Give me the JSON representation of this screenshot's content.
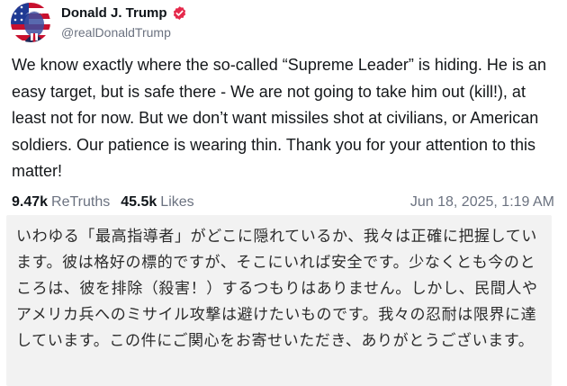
{
  "author": {
    "display_name": "Donald J. Trump",
    "handle": "@realDonaldTrump",
    "avatar_icon": "profile-photo-flag-icon",
    "verified_icon": "verified-badge-icon",
    "verified_color": "#e5294b"
  },
  "post": {
    "text": "We know exactly where the so-called “Supreme Leader” is hiding. He is an easy target, but is safe there - We are not going to take him out (kill!), at least not for now. But we don’t want missiles shot at civilians, or American soldiers. Our patience is wearing thin. Thank you for your attention to this matter!"
  },
  "stats": {
    "retruths_count": "9.47k",
    "retruths_label": "ReTruths",
    "likes_count": "45.5k",
    "likes_label": "Likes",
    "timestamp": "Jun 18, 2025, 1:19 AM"
  },
  "translation": {
    "text": "いわゆる「最高指導者」がどこに隠れているか、我々は正確に把握しています。彼は格好の標的ですが、そこにいれば安全です。少なくとも今のところは、彼を排除（殺害！）するつもりはありません。しかし、民間人やアメリカ兵へのミサイル攻撃は避けたいものです。我々の忍耐は限界に達しています。この件にご関心をお寄せいただき、ありがとうございます。",
    "background_color": "#f2f2f2"
  }
}
